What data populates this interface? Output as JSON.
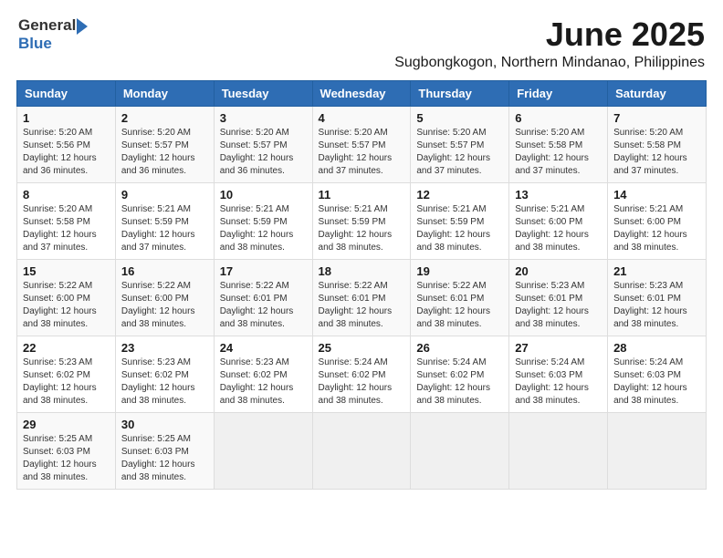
{
  "logo": {
    "general": "General",
    "blue": "Blue"
  },
  "title": "June 2025",
  "location": "Sugbongkogon, Northern Mindanao, Philippines",
  "weekdays": [
    "Sunday",
    "Monday",
    "Tuesday",
    "Wednesday",
    "Thursday",
    "Friday",
    "Saturday"
  ],
  "weeks": [
    [
      {
        "day": "1",
        "sunrise": "5:20 AM",
        "sunset": "5:56 PM",
        "daylight": "12 hours and 36 minutes."
      },
      {
        "day": "2",
        "sunrise": "5:20 AM",
        "sunset": "5:57 PM",
        "daylight": "12 hours and 36 minutes."
      },
      {
        "day": "3",
        "sunrise": "5:20 AM",
        "sunset": "5:57 PM",
        "daylight": "12 hours and 36 minutes."
      },
      {
        "day": "4",
        "sunrise": "5:20 AM",
        "sunset": "5:57 PM",
        "daylight": "12 hours and 37 minutes."
      },
      {
        "day": "5",
        "sunrise": "5:20 AM",
        "sunset": "5:57 PM",
        "daylight": "12 hours and 37 minutes."
      },
      {
        "day": "6",
        "sunrise": "5:20 AM",
        "sunset": "5:58 PM",
        "daylight": "12 hours and 37 minutes."
      },
      {
        "day": "7",
        "sunrise": "5:20 AM",
        "sunset": "5:58 PM",
        "daylight": "12 hours and 37 minutes."
      }
    ],
    [
      {
        "day": "8",
        "sunrise": "5:20 AM",
        "sunset": "5:58 PM",
        "daylight": "12 hours and 37 minutes."
      },
      {
        "day": "9",
        "sunrise": "5:21 AM",
        "sunset": "5:59 PM",
        "daylight": "12 hours and 37 minutes."
      },
      {
        "day": "10",
        "sunrise": "5:21 AM",
        "sunset": "5:59 PM",
        "daylight": "12 hours and 38 minutes."
      },
      {
        "day": "11",
        "sunrise": "5:21 AM",
        "sunset": "5:59 PM",
        "daylight": "12 hours and 38 minutes."
      },
      {
        "day": "12",
        "sunrise": "5:21 AM",
        "sunset": "5:59 PM",
        "daylight": "12 hours and 38 minutes."
      },
      {
        "day": "13",
        "sunrise": "5:21 AM",
        "sunset": "6:00 PM",
        "daylight": "12 hours and 38 minutes."
      },
      {
        "day": "14",
        "sunrise": "5:21 AM",
        "sunset": "6:00 PM",
        "daylight": "12 hours and 38 minutes."
      }
    ],
    [
      {
        "day": "15",
        "sunrise": "5:22 AM",
        "sunset": "6:00 PM",
        "daylight": "12 hours and 38 minutes."
      },
      {
        "day": "16",
        "sunrise": "5:22 AM",
        "sunset": "6:00 PM",
        "daylight": "12 hours and 38 minutes."
      },
      {
        "day": "17",
        "sunrise": "5:22 AM",
        "sunset": "6:01 PM",
        "daylight": "12 hours and 38 minutes."
      },
      {
        "day": "18",
        "sunrise": "5:22 AM",
        "sunset": "6:01 PM",
        "daylight": "12 hours and 38 minutes."
      },
      {
        "day": "19",
        "sunrise": "5:22 AM",
        "sunset": "6:01 PM",
        "daylight": "12 hours and 38 minutes."
      },
      {
        "day": "20",
        "sunrise": "5:23 AM",
        "sunset": "6:01 PM",
        "daylight": "12 hours and 38 minutes."
      },
      {
        "day": "21",
        "sunrise": "5:23 AM",
        "sunset": "6:01 PM",
        "daylight": "12 hours and 38 minutes."
      }
    ],
    [
      {
        "day": "22",
        "sunrise": "5:23 AM",
        "sunset": "6:02 PM",
        "daylight": "12 hours and 38 minutes."
      },
      {
        "day": "23",
        "sunrise": "5:23 AM",
        "sunset": "6:02 PM",
        "daylight": "12 hours and 38 minutes."
      },
      {
        "day": "24",
        "sunrise": "5:23 AM",
        "sunset": "6:02 PM",
        "daylight": "12 hours and 38 minutes."
      },
      {
        "day": "25",
        "sunrise": "5:24 AM",
        "sunset": "6:02 PM",
        "daylight": "12 hours and 38 minutes."
      },
      {
        "day": "26",
        "sunrise": "5:24 AM",
        "sunset": "6:02 PM",
        "daylight": "12 hours and 38 minutes."
      },
      {
        "day": "27",
        "sunrise": "5:24 AM",
        "sunset": "6:03 PM",
        "daylight": "12 hours and 38 minutes."
      },
      {
        "day": "28",
        "sunrise": "5:24 AM",
        "sunset": "6:03 PM",
        "daylight": "12 hours and 38 minutes."
      }
    ],
    [
      {
        "day": "29",
        "sunrise": "5:25 AM",
        "sunset": "6:03 PM",
        "daylight": "12 hours and 38 minutes."
      },
      {
        "day": "30",
        "sunrise": "5:25 AM",
        "sunset": "6:03 PM",
        "daylight": "12 hours and 38 minutes."
      },
      null,
      null,
      null,
      null,
      null
    ]
  ],
  "labels": {
    "sunrise_prefix": "Sunrise: ",
    "sunset_prefix": "Sunset: ",
    "daylight_prefix": "Daylight: "
  }
}
